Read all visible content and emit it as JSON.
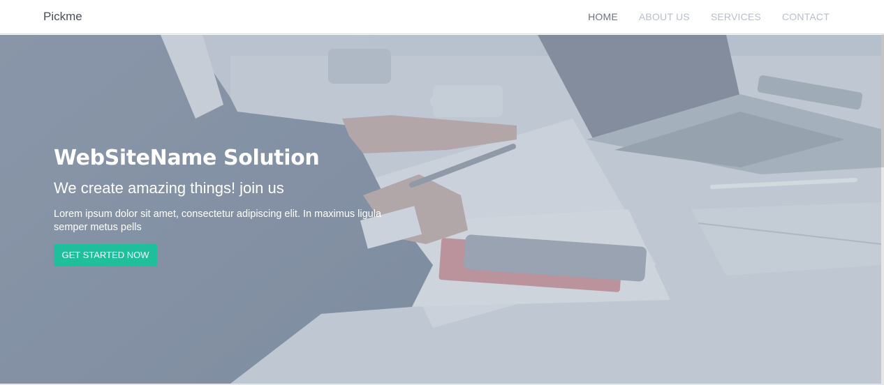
{
  "navbar": {
    "brand": "Pickme",
    "links": [
      {
        "label": "HOME",
        "active": true
      },
      {
        "label": "ABOUT US",
        "active": false
      },
      {
        "label": "SERVICES",
        "active": false
      },
      {
        "label": "CONTACT",
        "active": false
      }
    ]
  },
  "hero": {
    "title": "WebSiteName Solution",
    "subtitle": "We create amazing things! join us",
    "description": "Lorem ipsum dolor sit amet, consectetur adipiscing elit. In maximus ligula semper metus pells",
    "cta_label": "GET STARTED NOW",
    "background": "office-desk-photo"
  },
  "colors": {
    "accent": "#1fbf9c",
    "nav_active": "#6c7282",
    "nav_inactive": "#b9bfcc"
  }
}
